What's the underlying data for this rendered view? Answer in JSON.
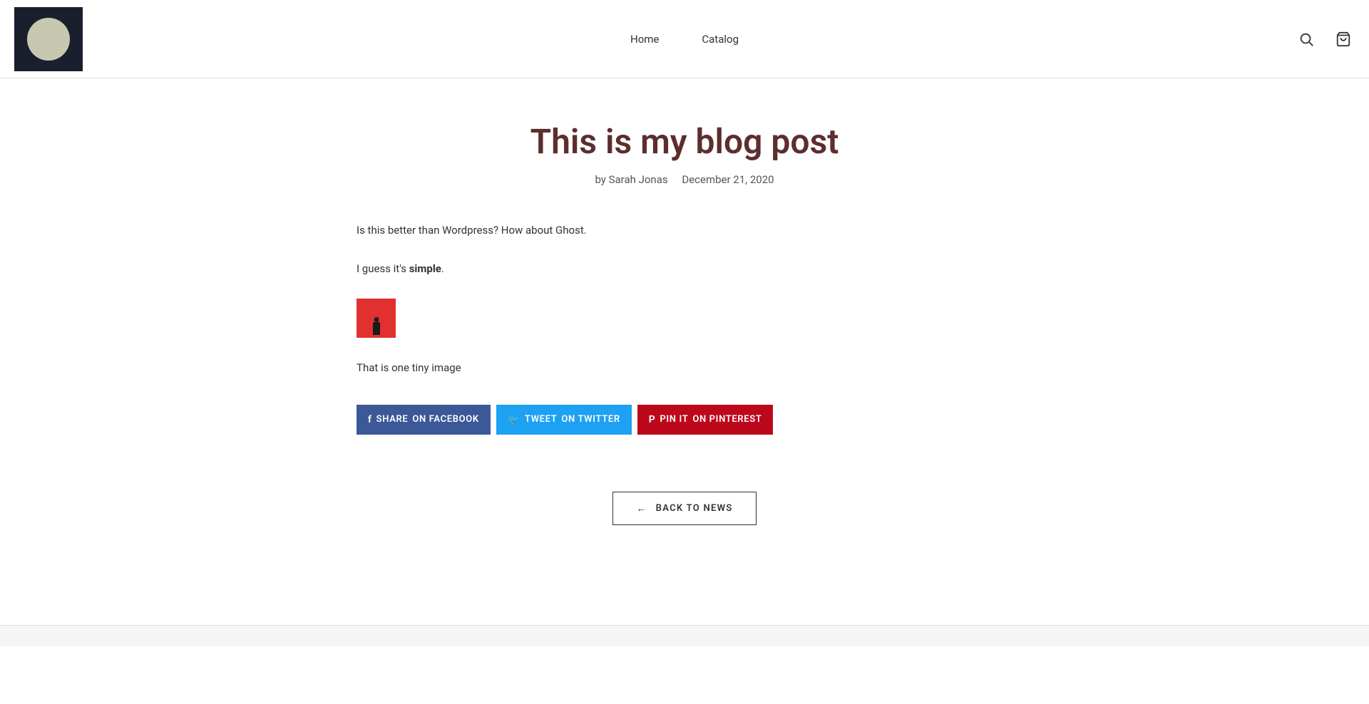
{
  "header": {
    "logo_alt": "Brand logo",
    "nav": {
      "home_label": "Home",
      "catalog_label": "Catalog"
    },
    "search_icon": "search-icon",
    "cart_icon": "cart-icon"
  },
  "post": {
    "title": "This is my blog post",
    "author": "by Sarah Jonas",
    "date": "December 21, 2020",
    "paragraph1": "Is this better than Wordpress? How about Ghost.",
    "paragraph2_prefix": "I guess it's ",
    "paragraph2_bold": "simple",
    "paragraph2_suffix": ".",
    "image_alt": "Tiny blog image",
    "caption": "That is one tiny image",
    "share": {
      "facebook_label": "SHARE",
      "facebook_sublabel": "ON FACEBOOK",
      "twitter_label": "TWEET",
      "twitter_sublabel": "ON TWITTER",
      "pinterest_label": "PIN IT",
      "pinterest_sublabel": "ON PINTEREST"
    }
  },
  "back_button": {
    "label": "BACK TO NEWS",
    "arrow": "←"
  }
}
